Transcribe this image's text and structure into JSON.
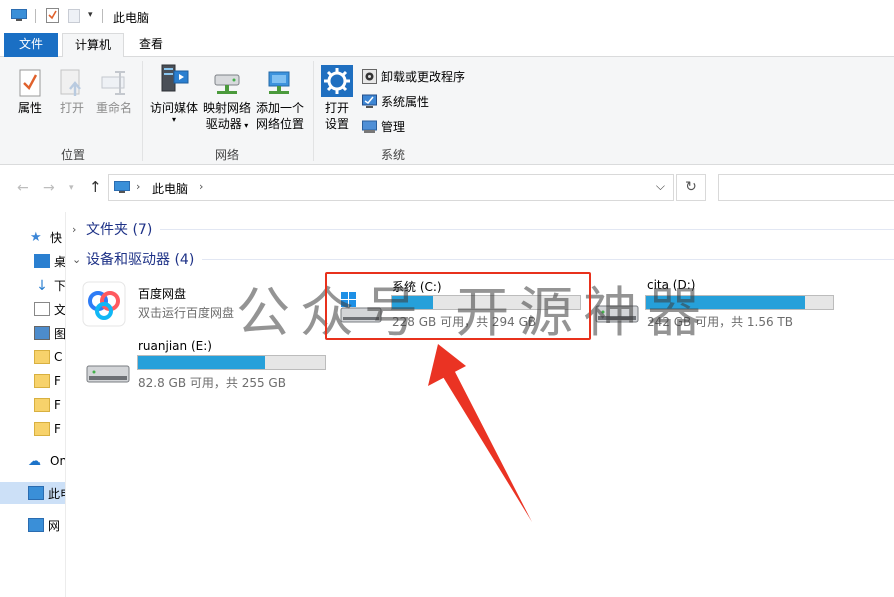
{
  "titlebar": {
    "title": "此电脑"
  },
  "tabs": {
    "file": "文件",
    "computer": "计算机",
    "view": "查看"
  },
  "ribbon": {
    "location": {
      "label": "位置",
      "properties": "属性",
      "open": "打开",
      "rename": "重命名"
    },
    "network": {
      "label": "网络",
      "access_media": "访问媒体",
      "map_drive_l1": "映射网络",
      "map_drive_l2": "驱动器",
      "add_location_l1": "添加一个",
      "add_location_l2": "网络位置"
    },
    "system": {
      "label": "系统",
      "open_settings_l1": "打开",
      "open_settings_l2": "设置",
      "uninstall": "卸载或更改程序",
      "system_properties": "系统属性",
      "manage": "管理"
    }
  },
  "address": {
    "path": "此电脑"
  },
  "navpane": {
    "items": [
      "快",
      "桌",
      "下",
      "文",
      "图",
      "C",
      "F",
      "F",
      "F",
      "On",
      "此电",
      "网"
    ]
  },
  "sections": {
    "folders": "文件夹 (7)",
    "devices": "设备和驱动器 (4)"
  },
  "devices": [
    {
      "name": "百度网盘",
      "sub": "双击运行百度网盘"
    },
    {
      "name": "系统 (C:)",
      "sub": "228 GB 可用，共 294 GB",
      "used_fraction": 0.22
    },
    {
      "name": "cita (D:)",
      "sub": "242 GB 可用，共 1.56 TB",
      "used_fraction": 0.85
    },
    {
      "name": "ruanjian (E:)",
      "sub": "82.8 GB 可用，共 255 GB",
      "used_fraction": 0.68
    }
  ],
  "watermark": "公众号 开源神器",
  "colors": {
    "accent": "#1a6fc4",
    "bar_fill": "#26a0da",
    "highlight_box": "#e8311c"
  }
}
